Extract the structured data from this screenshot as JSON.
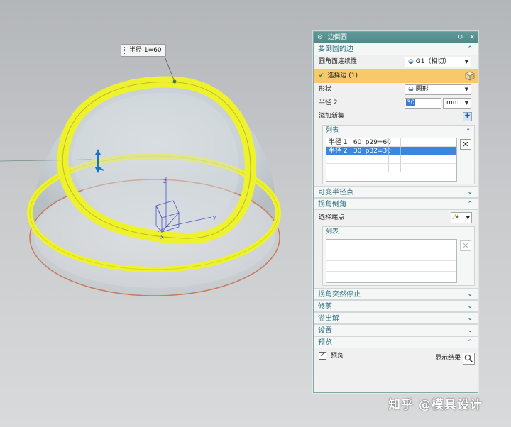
{
  "viewport": {
    "radius_tag": "半径 1=60",
    "axes": {
      "z": "Z",
      "y": "Y",
      "x": "X"
    }
  },
  "dialog": {
    "title": "边倒圆",
    "title_buttons": [
      "↺",
      "✕"
    ],
    "sections": {
      "edges": {
        "header": "要倒圆的边",
        "continuity_label": "圆角面连续性",
        "continuity_value": "G1（相切）",
        "select_label": "选择边 (1)",
        "shape_label": "形状",
        "shape_value": "圆形",
        "radius_label": "半径 2",
        "radius_value": "30",
        "unit_value": "mm",
        "add_set_label": "添加新集",
        "list": {
          "header": "列表",
          "rows": [
            {
              "name": "半径 1",
              "value": "60",
              "expr": "p29=60",
              "selected": false
            },
            {
              "name": "半径 2",
              "value": "30",
              "expr": "p32=30",
              "selected": true
            }
          ]
        }
      },
      "variable_radius": {
        "header": "可变半径点"
      },
      "corner_setback": {
        "header": "拐角倒角",
        "select_endpoint_label": "选择端点",
        "list_header": "列表"
      },
      "corner_stop": {
        "header": "拐角突然停止"
      },
      "trim": {
        "header": "修剪"
      },
      "overflow": {
        "header": "溢出解"
      },
      "settings": {
        "header": "设置"
      },
      "preview": {
        "header": "预览",
        "preview_checkbox_label": "预览",
        "show_result_label": "显示结果"
      }
    }
  },
  "watermark": "知乎 @模具设计",
  "colors": {
    "title_bar": "#5a9593",
    "section_text": "#2c6f7b",
    "selection_row": "#f9c86b",
    "list_selected": "#3d86df",
    "fillet": "#ecf02e"
  }
}
